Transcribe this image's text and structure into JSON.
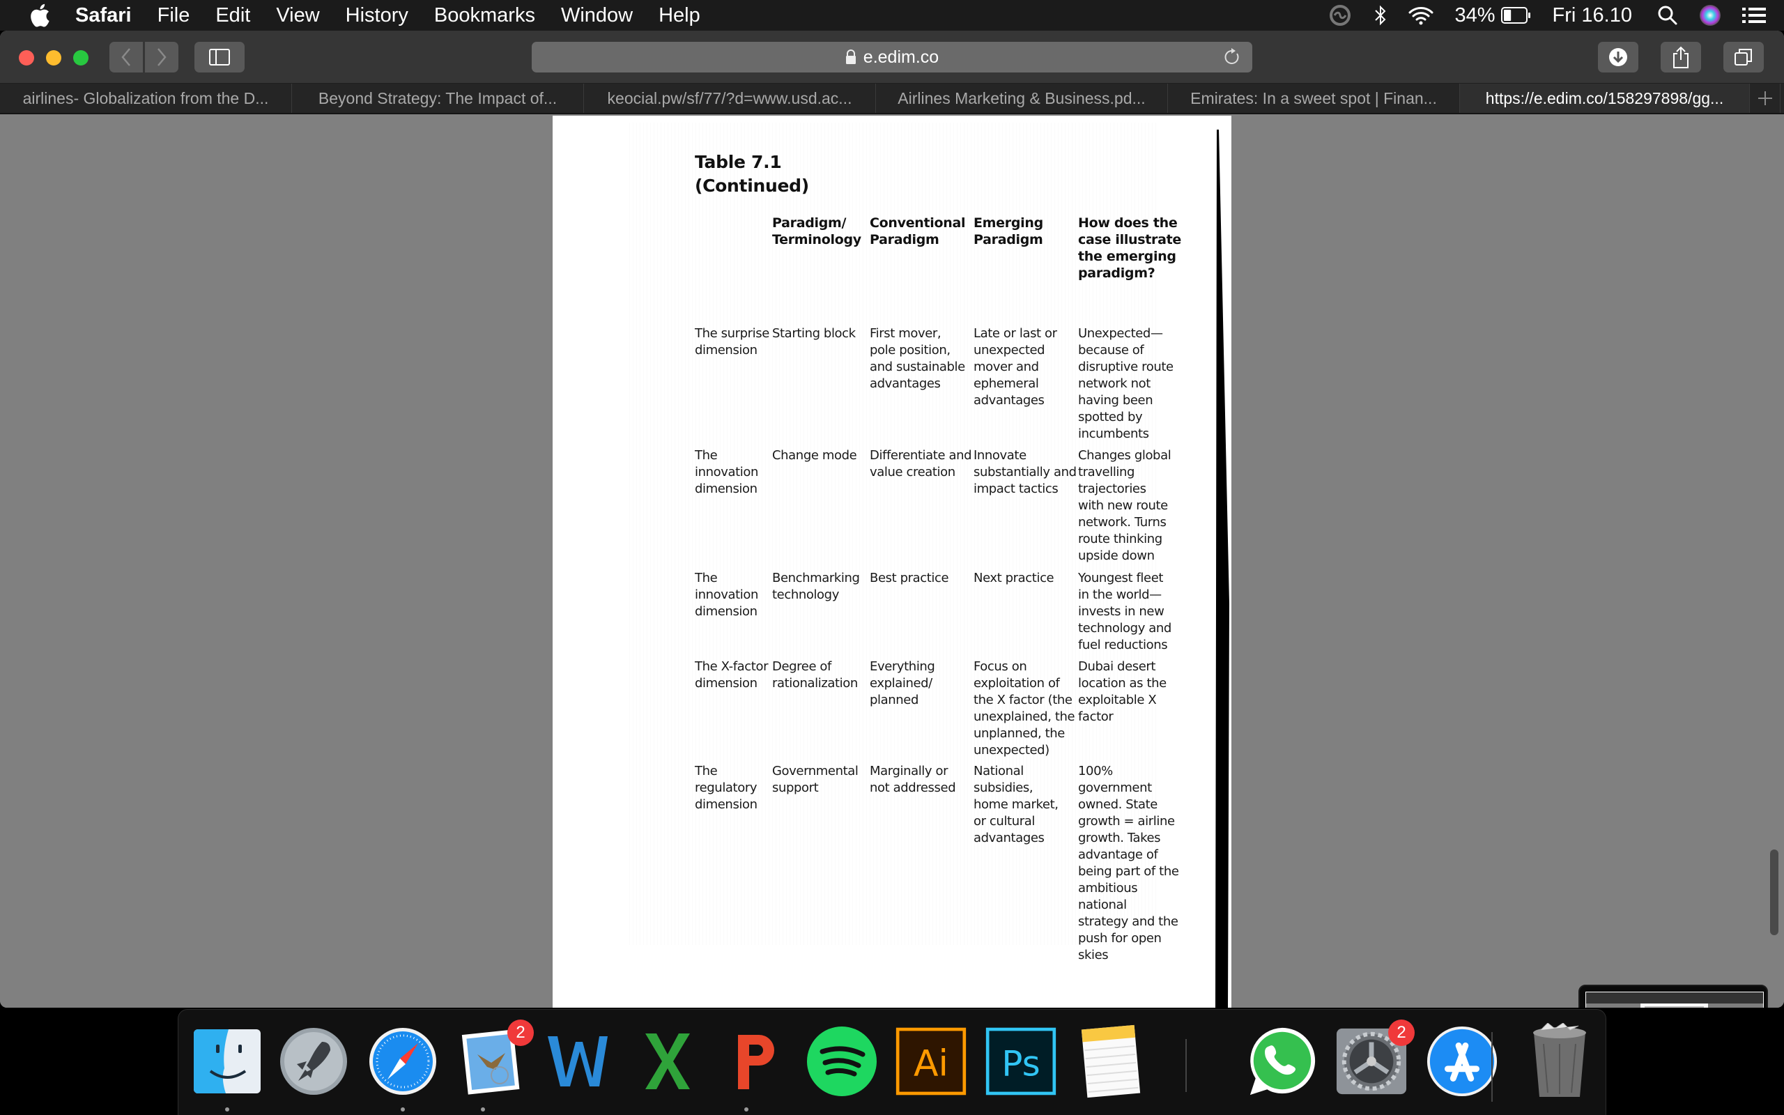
{
  "menubar": {
    "apple": "Apple",
    "app_name": "Safari",
    "menus": [
      "File",
      "Edit",
      "View",
      "History",
      "Bookmarks",
      "Window",
      "Help"
    ],
    "status": {
      "battery_percent": "34%",
      "battery_level": 0.34,
      "clock": "Fri 16.10"
    }
  },
  "browser": {
    "address": "e.edim.co",
    "tabs": [
      {
        "label": "airlines- Globalization from the D...",
        "active": false
      },
      {
        "label": "Beyond Strategy: The Impact of...",
        "active": false
      },
      {
        "label": "keocial.pw/sf/77/?d=www.usd.ac...",
        "active": false
      },
      {
        "label": "Airlines Marketing & Business.pd...",
        "active": false
      },
      {
        "label": "Emirates: In a sweet spot | Finan...",
        "active": false
      },
      {
        "label": "https://e.edim.co/158297898/gg...",
        "active": true
      }
    ],
    "new_tab": "+"
  },
  "document": {
    "title_line1": "Table 7.1",
    "title_line2": "(Continued)",
    "headers": [
      "",
      "Paradigm/\nTerminology",
      "Conventional\nParadigm",
      "Emerging\nParadigm",
      "How does the\ncase illustrate\nthe emerging\nparadigm?"
    ],
    "rows": [
      [
        "The surprise\ndimension",
        "Starting block",
        "First mover,\npole position,\nand sustainable\nadvantages",
        "Late or last or\nunexpected\nmover and\nephemeral\nadvantages",
        "Unexpected—\nbecause of\ndisruptive route\nnetwork not\nhaving been\nspotted by\nincumbents"
      ],
      [
        "The\ninnovation\ndimension",
        "Change mode",
        "Differentiate and\nvalue creation",
        "Innovate\nsubstantially and\nimpact tactics",
        "Changes global\ntravelling\ntrajectories\nwith new route\nnetwork. Turns\nroute thinking\nupside down"
      ],
      [
        "The\ninnovation\ndimension",
        "Benchmarking\ntechnology",
        "Best practice",
        "Next practice",
        "Youngest fleet\nin the world—\ninvests in new\ntechnology and\nfuel reductions"
      ],
      [
        "The X-factor\ndimension",
        "Degree of\nrationalization",
        "Everything\nexplained/\nplanned",
        "Focus on\nexploitation of\nthe X factor (the\nunexplained, the\nunplanned, the\nunexpected)",
        "Dubai desert\nlocation as the\nexploitable X\nfactor"
      ],
      [
        "The\nregulatory\ndimension",
        "Governmental\nsupport",
        "Marginally or\nnot addressed",
        "National\nsubsidies,\nhome market,\nor cultural\nadvantages",
        "100% government\nowned. State\ngrowth = airline\ngrowth. Takes\nadvantage of\nbeing part of the\nambitious national\nstrategy and the\npush for open\nskies"
      ]
    ]
  },
  "dock": {
    "apps": [
      {
        "name": "Finder",
        "running": true,
        "badge": null
      },
      {
        "name": "Launchpad",
        "running": false,
        "badge": null
      },
      {
        "name": "Safari",
        "running": true,
        "badge": null
      },
      {
        "name": "Mail",
        "running": true,
        "badge": "2"
      },
      {
        "name": "Microsoft Word",
        "running": false,
        "badge": null
      },
      {
        "name": "Microsoft Excel",
        "running": false,
        "badge": null
      },
      {
        "name": "Microsoft PowerPoint",
        "running": true,
        "badge": null
      },
      {
        "name": "Spotify",
        "running": false,
        "badge": null
      },
      {
        "name": "Adobe Illustrator",
        "running": false,
        "badge": null,
        "label": "Ai"
      },
      {
        "name": "Adobe Photoshop",
        "running": false,
        "badge": null,
        "label": "Ps"
      },
      {
        "name": "Notes",
        "running": false,
        "badge": null
      },
      {
        "name": "WhatsApp",
        "running": false,
        "badge": null
      },
      {
        "name": "System Preferences",
        "running": false,
        "badge": "2"
      },
      {
        "name": "App Store",
        "running": false,
        "badge": null
      },
      {
        "name": "Trash",
        "running": false,
        "badge": null
      }
    ]
  },
  "colors": {
    "menubar_bg": "#1b1b1b",
    "toolbar_bg": "#363636",
    "content_bg": "#808080",
    "badge_red": "#f0393a"
  }
}
